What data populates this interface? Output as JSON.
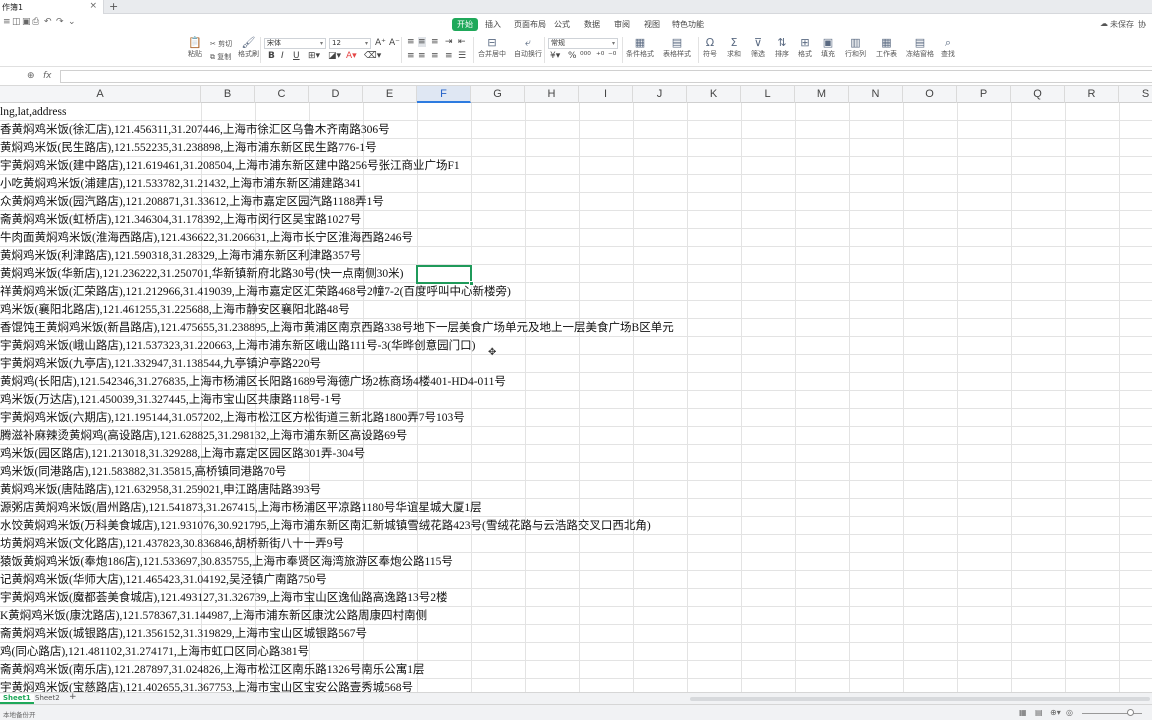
{
  "window": {
    "doc_tab": "作簿1",
    "close_glyph": "×",
    "add_glyph": "+"
  },
  "menu": {
    "tabs": [
      "开始",
      "插入",
      "页面布局",
      "公式",
      "数据",
      "审阅",
      "视图",
      "特色功能"
    ],
    "active_tab": "开始",
    "right_tools": [
      "未保存",
      "协"
    ]
  },
  "ribbon": {
    "paste": "粘贴",
    "cut": "剪切",
    "copy": "复制",
    "format_painter": "格式刷",
    "font_name": "宋体",
    "font_size": "12",
    "number_format": "常规",
    "merge_center": "合并居中",
    "wrap_text": "自动换行",
    "conditional_format": "条件格式",
    "table_style": "表格样式",
    "symbol": "符号",
    "sum": "求和",
    "filter": "筛选",
    "sort": "排序",
    "format": "格式",
    "fill": "填充",
    "row_col": "行和列",
    "worksheet": "工作表",
    "freeze": "冻结窗格",
    "find": "查找"
  },
  "formula_bar": {
    "fx_label": "fx",
    "value": ""
  },
  "columns": [
    "A",
    "B",
    "C",
    "D",
    "E",
    "F",
    "G",
    "H",
    "I",
    "J",
    "K",
    "L",
    "M",
    "N",
    "O",
    "P",
    "Q",
    "R",
    "S"
  ],
  "selected_column": "F",
  "rows": [
    "lng,lat,address",
    "香黄焖鸡米饭(徐汇店),121.456311,31.207446,上海市徐汇区乌鲁木齐南路306号",
    "黄焖鸡米饭(民生路店),121.552235,31.238898,上海市浦东新区民生路776-1号",
    "宇黄焖鸡米饭(建中路店),121.619461,31.208504,上海市浦东新区建中路256号张江商业广场F1",
    "小吃黄焖鸡米饭(浦建店),121.533782,31.21432,上海市浦东新区浦建路341",
    "众黄焖鸡米饭(园汽路店),121.208871,31.33612,上海市嘉定区园汽路1188弄1号",
    "斋黄焖鸡米饭(虹桥店),121.346304,31.178392,上海市闵行区吴宝路1027号",
    "牛肉面黄焖鸡米饭(淮海西路店),121.436622,31.206631,上海市长宁区淮海西路246号",
    "黄焖鸡米饭(利津路店),121.590318,31.28329,上海市浦东新区利津路357号",
    "黄焖鸡米饭(华新店),121.236222,31.250701,华新镇新府北路30号(快一点南侧30米)",
    "祥黄焖鸡米饭(汇荣路店),121.212966,31.419039,上海市嘉定区汇荣路468号2幢7-2(百度呼叫中心新楼旁)",
    "鸡米饭(襄阳北路店),121.461255,31.225688,上海市静安区襄阳北路48号",
    "香馄饨王黄焖鸡米饭(新昌路店),121.475655,31.238895,上海市黄浦区南京西路338号地下一层美食广场单元及地上一层美食广场B区单元",
    "宇黄焖鸡米饭(峨山路店),121.537323,31.220663,上海市浦东新区峨山路111号-3(华晔创意园门口)",
    "宇黄焖鸡米饭(九亭店),121.332947,31.138544,九亭镇沪亭路220号",
    "黄焖鸡(长阳店),121.542346,31.276835,上海市杨浦区长阳路1689号海德广场2栋商场4楼401-HD4-011号",
    "鸡米饭(万达店),121.450039,31.327445,上海市宝山区共康路118号-1号",
    "宇黄焖鸡米饭(六期店),121.195144,31.057202,上海市松江区方松街道三新北路1800弄7号103号",
    "腾滋补麻辣烫黄焖鸡(高设路店),121.628825,31.298132,上海市浦东新区高设路69号",
    "鸡米饭(园区路店),121.213018,31.329288,上海市嘉定区园区路301弄-304号",
    "鸡米饭(同港路店),121.583882,31.35815,高桥镇同港路70号",
    "黄焖鸡米饭(唐陆路店),121.632958,31.259021,申江路唐陆路393号",
    "源粥店黄焖鸡米饭(眉州路店),121.541873,31.267415,上海市杨浦区平凉路1180号华谊星城大厦1层",
    "水饺黄焖鸡米饭(万科美食城店),121.931076,30.921795,上海市浦东新区南汇新城镇雪绒花路423号(雪绒花路与云浩路交叉口西北角)",
    "坊黄焖鸡米饭(文化路店),121.437823,30.836846,胡桥新街八十一弄9号",
    "猿饭黄焖鸡米饭(奉炮186店),121.533697,30.835755,上海市奉贤区海湾旅游区奉炮公路115号",
    "记黄焖鸡米饭(华师大店),121.465423,31.04192,吴泾镇广南路750号",
    "宇黄焖鸡米饭(魔都荟美食城店),121.493127,31.326739,上海市宝山区逸仙路高逸路13号2楼",
    "K黄焖鸡米饭(康沈路店),121.578367,31.144987,上海市浦东新区康沈公路周康四村南侧",
    "斋黄焖鸡米饭(城银路店),121.356152,31.319829,上海市宝山区城银路567号",
    "鸡(同心路店),121.481102,31.274171,上海市虹口区同心路381号",
    "斋黄焖鸡米饭(南乐店),121.287897,31.024826,上海市松江区南乐路1326号南乐公寓1层",
    "宇黄焖鸡米饭(宝慈路店),121.402655,31.367753,上海市宝山区宝安公路壹秀城568号"
  ],
  "sheets": {
    "tabs": [
      "Sheet1",
      "Sheet2"
    ],
    "active": "Sheet1",
    "add_glyph": "+"
  },
  "status": {
    "left_text": "本地备份开"
  }
}
